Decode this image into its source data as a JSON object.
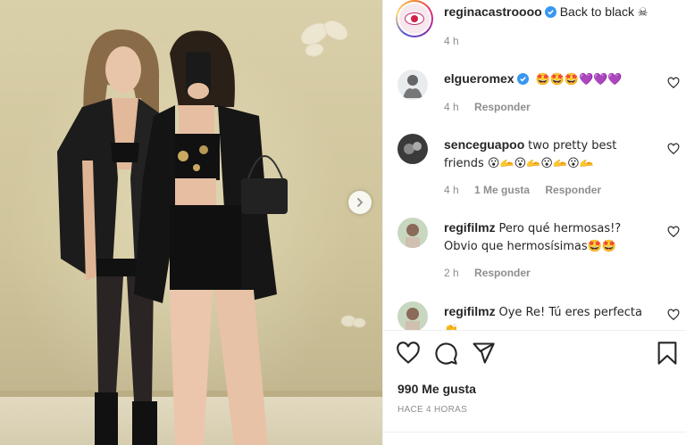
{
  "post": {
    "author": "reginacastroooo",
    "caption": "Back to black",
    "caption_emoji": "☠",
    "caption_time": "4 h",
    "likes": "990 Me gusta",
    "posted_ago": "HACE 4 HORAS"
  },
  "comments": [
    {
      "username": "elgueromex",
      "verified": true,
      "text": "🤩🤩🤩💜💜💜",
      "time": "4 h",
      "likes": "",
      "reply": "Responder"
    },
    {
      "username": "senceguapoo",
      "verified": false,
      "text": "two pretty best friends 😮🫴😮🫴😮🫴😮🫴",
      "time": "4 h",
      "likes": "1 Me gusta",
      "reply": "Responder"
    },
    {
      "username": "regifilmz",
      "verified": false,
      "text": "Pero qué hermosas!? Obvio que hermosísimas🤩🤩",
      "time": "2 h",
      "likes": "",
      "reply": "Responder"
    },
    {
      "username": "regifilmz",
      "verified": false,
      "text": "Oye Re! Tú eres perfecta 👏",
      "time": "",
      "likes": "",
      "reply": ""
    }
  ],
  "icons": {
    "verified_color": "#3897f0",
    "like": "heart-icon",
    "comment": "comment-icon",
    "share": "share-icon",
    "save": "bookmark-icon",
    "next": "chevron-right-icon"
  }
}
